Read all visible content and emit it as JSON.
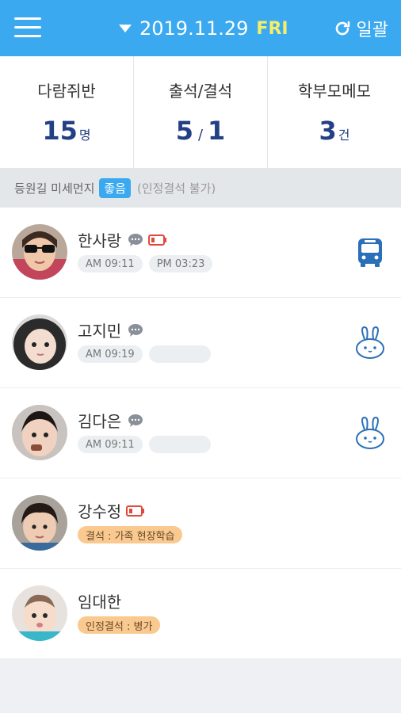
{
  "header": {
    "date": "2019.11.29",
    "day": "FRI",
    "bulk_label": "일괄",
    "colors": {
      "bar": "#3aa9f0",
      "day": "#f4ef6b"
    }
  },
  "stats": [
    {
      "label": "다람쥐반",
      "value": "15",
      "unit": "명"
    },
    {
      "label": "출석/결석",
      "present": "5",
      "sep": "/",
      "absent": "1"
    },
    {
      "label": "학부모메모",
      "value": "3",
      "unit": "건"
    }
  ],
  "dust": {
    "label": "등원길 미세먼지",
    "level": "좋음",
    "note": "(인정결석 불가)"
  },
  "children": [
    {
      "name": "한사랑",
      "times": [
        "AM 09:11",
        "PM 03:23"
      ],
      "icon": "bus-icon"
    },
    {
      "name": "고지민",
      "times": [
        "AM 09:19"
      ],
      "icon": "rabbit-icon"
    },
    {
      "name": "김다은",
      "times": [
        "AM 09:11"
      ],
      "icon": "rabbit-icon"
    },
    {
      "name": "강수정",
      "status": "결석 : 가족 현장학습"
    },
    {
      "name": "임대한",
      "status": "인정결석 : 병가"
    }
  ]
}
